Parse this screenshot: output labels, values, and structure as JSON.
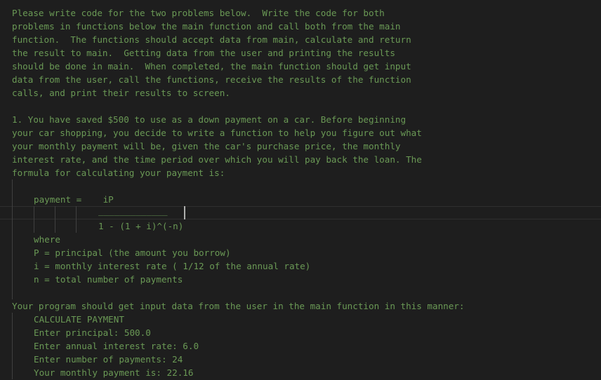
{
  "intro_lines": [
    "Please write code for the two problems below.  Write the code for both",
    "problems in functions below the main function and call both from the main",
    "function.  The functions should accept data from main, calculate and return",
    "the result to main.  Getting data from the user and printing the results",
    "should be done in main.  When completed, the main function should get input",
    "data from the user, call the functions, receive the results of the function",
    "calls, and print their results to screen."
  ],
  "problem1_lines": [
    "1. You have saved $500 to use as a down payment on a car. Before beginning",
    "your car shopping, you decide to write a function to help you figure out what",
    "your monthly payment will be, given the car's purchase price, the monthly",
    "interest rate, and the time period over which you will pay back the loan. The",
    "formula for calculating your payment is:"
  ],
  "formula": {
    "numerator_line": "payment =    iP",
    "fraction_bar": "_____________",
    "denominator": "1 - (1 + i)^(-n)"
  },
  "where_lines": [
    "where",
    "P = principal (the amount you borrow)",
    "i = monthly interest rate ( 1/12 of the annual rate)",
    "n = total number of payments"
  ],
  "program_intro": "Your program should get input data from the user in the main function in this manner:",
  "sample_output": [
    "CALCULATE PAYMENT",
    "Enter principal: 500.0",
    "Enter annual interest rate: 6.0",
    "Enter number of payments: 24",
    "Your monthly payment is: 22.16"
  ]
}
